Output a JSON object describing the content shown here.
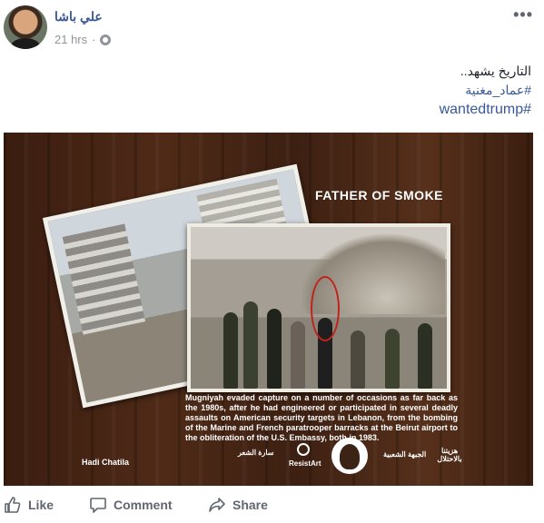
{
  "post": {
    "author": "علي باشا",
    "time": "21 hrs",
    "privacy_icon": "globe-icon",
    "menu_icon": "more-icon",
    "text_line": "التاريخ يشهد..",
    "hashtags": [
      "#عماد_مغنية",
      "#wantedtrump"
    ]
  },
  "image": {
    "title": "FATHER OF SMOKE",
    "caption": "Mugniyah evaded capture on a number of occasions as far back as the 1980s, after he had engineered or participated in several deadly assaults on American security targets in Lebanon, from the bombing of the Marine and French paratrooper barracks at the Beirut airport to the obliteration of the U.S. Embassy, both in 1983.",
    "credit": "Hadi Chatila",
    "logos": [
      "سارة الشعر",
      "ResistArt",
      "الجبهة الشعبية",
      "هزيتنا بالاحتلال"
    ]
  },
  "actions": {
    "like": "Like",
    "comment": "Comment",
    "share": "Share"
  },
  "colors": {
    "link": "#385898",
    "muted": "#90949c",
    "action": "#606770"
  }
}
